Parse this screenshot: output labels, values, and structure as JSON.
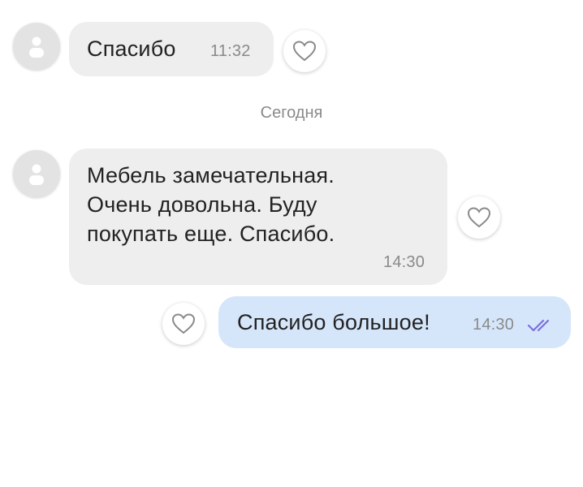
{
  "messages": [
    {
      "direction": "incoming",
      "text": "Спасибо",
      "time": "11:32"
    },
    {
      "direction": "incoming",
      "text": "Мебель замечательная. Очень довольна. Буду покупать еще. Спасибо.",
      "time": "14:30"
    },
    {
      "direction": "outgoing",
      "text": "Спасибо большое!",
      "time": "14:30",
      "status": "read"
    }
  ],
  "date_separator": "Сегодня",
  "icons": {
    "avatar": "user-placeholder-icon",
    "like": "heart-outline-icon",
    "read_receipt": "double-check-icon"
  },
  "colors": {
    "incoming_bubble": "#eeeeee",
    "outgoing_bubble": "#d5e6fa",
    "read_receipt": "#7a6fe0",
    "timestamp": "#8a8a8a"
  }
}
